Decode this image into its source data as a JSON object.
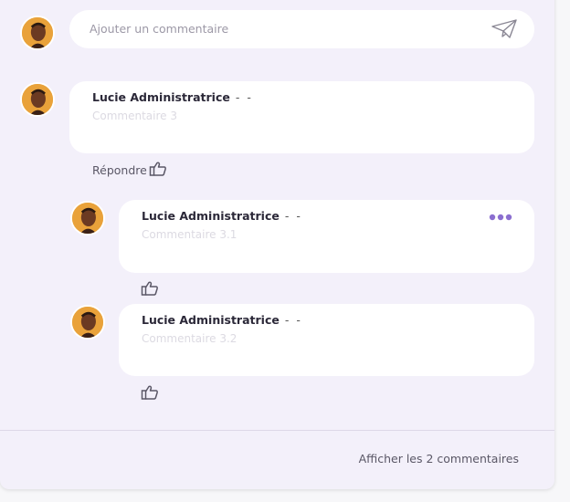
{
  "composer": {
    "placeholder": "Ajouter un commentaire",
    "send_icon": "paper-plane-icon"
  },
  "comments": [
    {
      "author": "Lucie Administratrice",
      "meta": "- -",
      "text": "Commentaire 3",
      "reply_label": "Répondre",
      "like_icon": "thumbs-up-icon"
    }
  ],
  "replies": [
    {
      "author": "Lucie Administratrice",
      "meta": "- -",
      "text": "Commentaire 3.1",
      "like_icon": "thumbs-up-icon",
      "menu_icon": "more-horizontal-icon"
    },
    {
      "author": "Lucie Administratrice",
      "meta": "- -",
      "text": "Commentaire 3.2",
      "like_icon": "thumbs-up-icon"
    }
  ],
  "footer": {
    "show_more_label": "Afficher les 2 commentaires"
  },
  "colors": {
    "card_background": "#f3f0fa",
    "accent": "#8b6fd0",
    "text_dark": "#2b2838",
    "placeholder": "#9c98a6"
  }
}
